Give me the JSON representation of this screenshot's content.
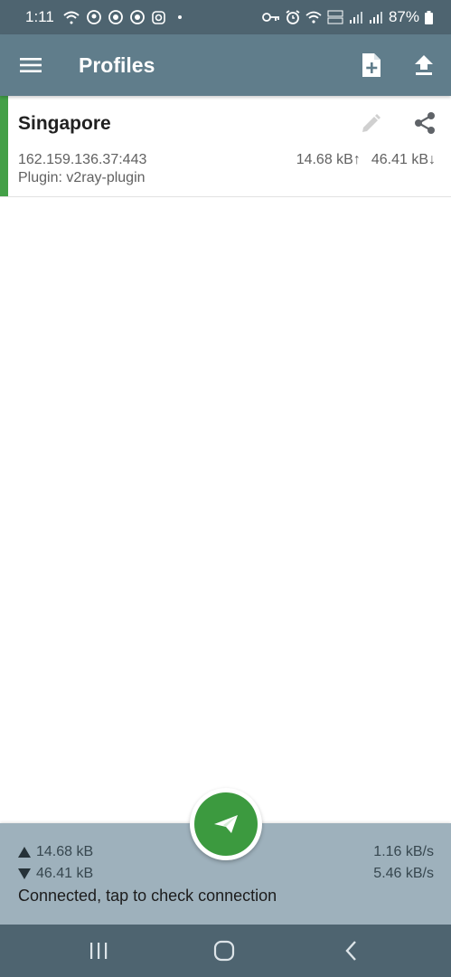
{
  "status_bar": {
    "time": "1:11",
    "battery": "87%",
    "icons_left": [
      "wifi-hotspot-icon",
      "pm-icon",
      "vpn-tunnel-icon",
      "vpn-tunnel-icon",
      "instagram-icon",
      "dot"
    ],
    "icons_right": [
      "vpn-key-icon",
      "alarm-icon",
      "wifi-icon",
      "volte-icon",
      "signal-icon",
      "signal-icon",
      "battery-icon"
    ]
  },
  "toolbar": {
    "title": "Profiles",
    "menu_icon": "menu-icon",
    "add_icon": "add-profile-icon",
    "upload_icon": "upload-icon"
  },
  "profiles": [
    {
      "name": "Singapore",
      "address": "162.159.136.37:443",
      "plugin": "Plugin: v2ray-plugin",
      "tx": "14.68 kB↑",
      "rx": "46.41 kB↓",
      "active": true
    }
  ],
  "stats": {
    "tx_total": "14.68 kB",
    "rx_total": "46.41 kB",
    "tx_rate": "1.16 kB/s",
    "rx_rate": "5.46 kB/s",
    "status": "Connected, tap to check connection"
  },
  "colors": {
    "toolbar": "#607d8b",
    "status_bar": "#4e6470",
    "accent_green": "#3c9a3f",
    "active_indicator": "#43a047",
    "bottom_panel": "#9eb1bc"
  }
}
